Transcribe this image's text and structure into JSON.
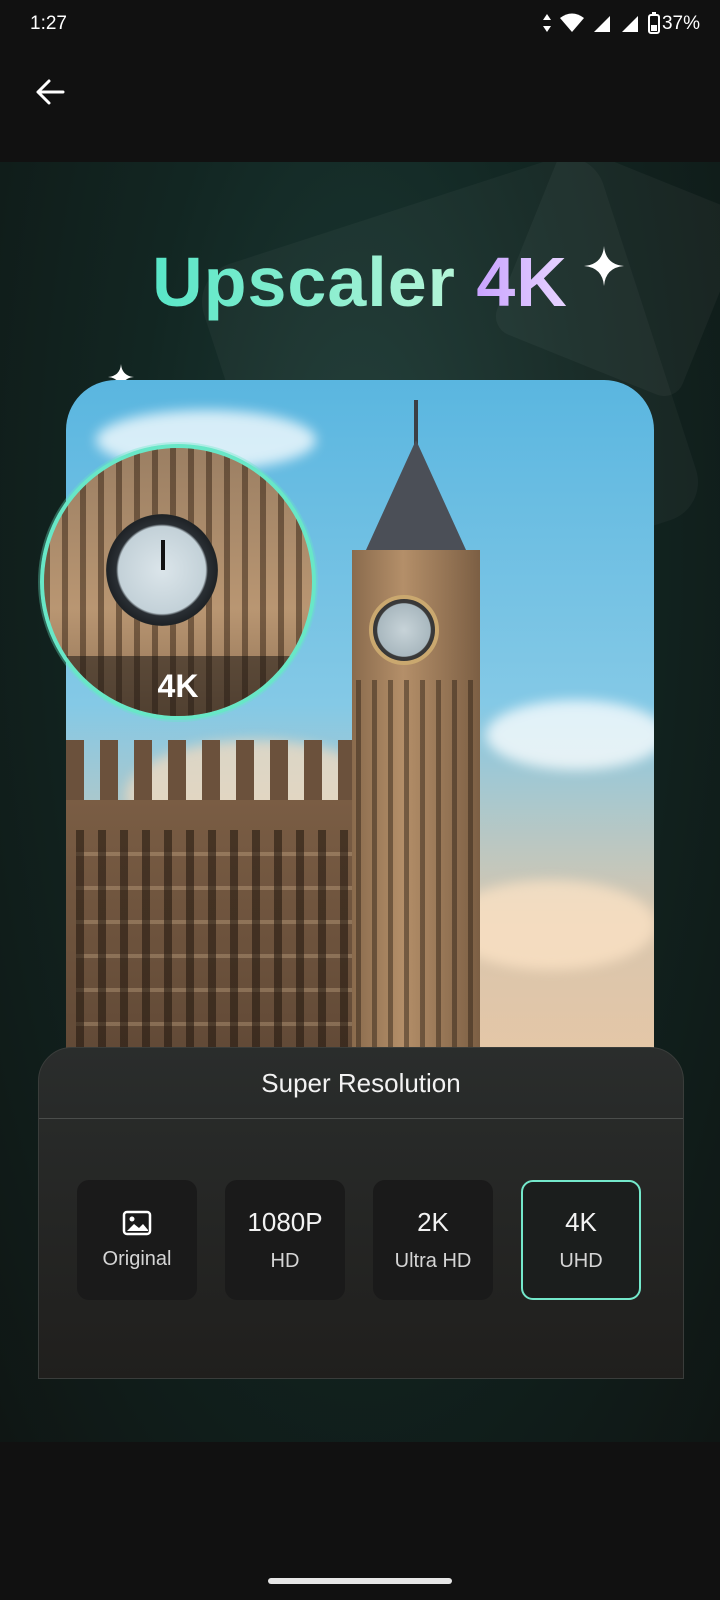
{
  "status_bar": {
    "time": "1:27",
    "battery": "37%"
  },
  "app_bar": {
    "back_icon": "arrow-left-icon"
  },
  "hero": {
    "title_main": "Upscaler",
    "title_accent": "4K",
    "lens_label": "4K"
  },
  "panel": {
    "title": "Super Resolution",
    "options": [
      {
        "main": "Original",
        "sub": "",
        "icon": "image-icon",
        "selected": false
      },
      {
        "main": "1080P",
        "sub": "HD",
        "selected": false
      },
      {
        "main": "2K",
        "sub": "Ultra HD",
        "selected": false
      },
      {
        "main": "4K",
        "sub": "UHD",
        "selected": true
      }
    ]
  },
  "colors": {
    "accent_teal": "#74e8cb",
    "accent_purple": "#d8b8ff",
    "background": "#111111"
  }
}
